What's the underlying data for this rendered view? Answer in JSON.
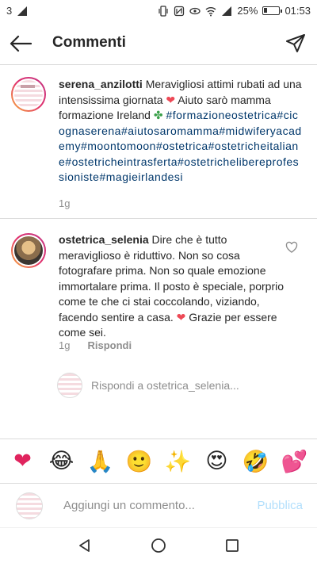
{
  "status_bar": {
    "carrier_count": "3",
    "battery_percent": "25%",
    "battery_level": 0.25,
    "time": "01:53",
    "icons": [
      "signal-icon",
      "vibrate-icon",
      "nfc-icon",
      "eye-icon",
      "wifi-icon",
      "cellular-icon",
      "battery-icon"
    ]
  },
  "header": {
    "title": "Commenti",
    "back_icon": "arrow-left-icon",
    "send_icon": "paper-plane-icon"
  },
  "caption": {
    "username": "serena_anzilotti",
    "text_before": "Meravigliosi attimi rubati ad una intensissima giornata",
    "heart": "❤",
    "text_after": "Aiuto sarò mamma formazione Ireland",
    "clover": "✤",
    "hashtags": "#formazioneostetrica#cicognaserena#aiutosaromamma#midwiferyacademy#moontomoon#ostetrica#ostetricheitaliane#ostetricheintrasferta#ostetrichelibereprofessioniste#magieirlandesi",
    "time": "1g"
  },
  "comment": {
    "username": "ostetrica_selenia",
    "text": "Dire che è tutto meraviglioso è riduttivo. Non so cosa fotografare prima. Non so quale emozione immortalare prima. Il posto è speciale, porprio come te che ci stai coccolando, viziando, facendo sentire a casa.",
    "heart": "❤",
    "text_after": "Grazie per essere come sei.",
    "time": "1g",
    "reply_label": "Rispondi",
    "like_icon": "heart-outline-icon"
  },
  "reply_input": {
    "placeholder": "Rispondi a ostetrica_selenia..."
  },
  "emoji_bar": {
    "emojis": [
      "❤",
      "😂",
      "🙏",
      "🙂",
      "✨",
      "😍",
      "🤣",
      "💕"
    ]
  },
  "add_comment": {
    "placeholder": "Aggiungi un commento...",
    "publish_label": "Pubblica"
  },
  "nav_bar": {
    "icons": [
      "back-triangle-icon",
      "home-circle-icon",
      "recents-square-icon"
    ]
  }
}
